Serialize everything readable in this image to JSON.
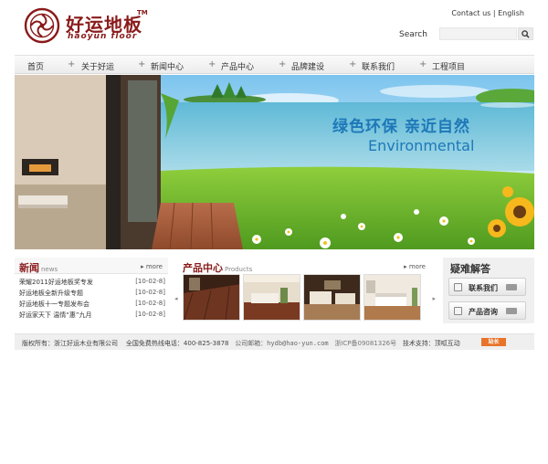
{
  "header": {
    "logo_cn": "好运地板",
    "logo_tm": "TM",
    "logo_en": "haoyun floor",
    "top_links": {
      "contact": "Contact us",
      "separator": "|",
      "english": "English"
    },
    "search": {
      "label": "Search",
      "value": "",
      "button_icon": "search-icon"
    }
  },
  "nav": {
    "items": [
      "首页",
      "关于好运",
      "新闻中心",
      "产品中心",
      "品牌建设",
      "联系我们",
      "工程项目"
    ],
    "separator": "+"
  },
  "banner": {
    "slogan_cn": "绿色环保 亲近自然",
    "slogan_en": "Environmental"
  },
  "news": {
    "title": "新闻",
    "subtitle": "news",
    "more": "more",
    "items": [
      {
        "title": "荣耀2011好运地板奖专发",
        "date": "[10-02-8]"
      },
      {
        "title": "好运地板全新升级专题",
        "date": "[10-02-8]"
      },
      {
        "title": "好运地板十一专题发布会",
        "date": "[10-02-8]"
      },
      {
        "title": "好运家天下 温情“惠”九月",
        "date": "[10-02-8]"
      }
    ]
  },
  "products": {
    "title": "产品中心",
    "subtitle": "Products",
    "more": "more",
    "prev_icon": "arrow-left-icon",
    "next_icon": "arrow-right-icon"
  },
  "faq": {
    "title": "疑难解答",
    "buttons": [
      {
        "label": "联系我们",
        "icon": "contact-icon"
      },
      {
        "label": "产品咨询",
        "icon": "consult-icon"
      }
    ]
  },
  "footer": {
    "copyright": "版权所有：浙江好运木业有限公司",
    "hotline": "全国免费热线电话：400-825-3878",
    "email": "公司邮箱：hydb@hao-yun.com",
    "icp": "浙ICP备09081326号",
    "support": "技术支持：顶呱互动",
    "badge": "站长"
  },
  "colors": {
    "brand_red": "#8a1a1a",
    "banner_blue": "#1d78b8",
    "footer_badge": "#e8732a"
  }
}
